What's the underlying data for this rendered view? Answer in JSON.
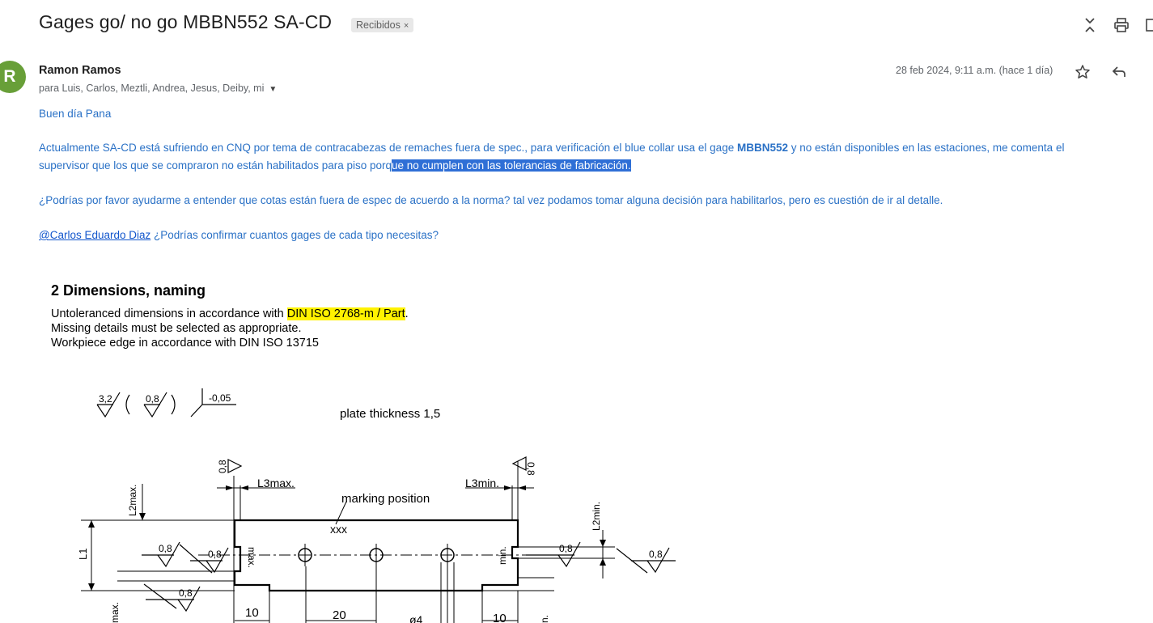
{
  "email": {
    "subject": "Gages go/ no go MBBN552 SA-CD",
    "label": "Recibidos",
    "label_close": "×",
    "avatar_letter": "R",
    "sender_name": "Ramon Ramos",
    "recipients": "para Luis, Carlos, Meztli, Andrea, Jesus, Deiby, mi",
    "date": "28 feb 2024, 9:11 a.m. (hace 1 día)",
    "greeting": "Buen día Pana",
    "para1_a": "Actualmente SA-CD está sufriendo en CNQ por tema de contracabezas de remaches fuera de spec.,  para verificación el blue collar usa el gage ",
    "para1_bold": "MBBN552",
    "para1_b": " y no están disponibles en las estaciones, me comenta el",
    "para1_c": "supervisor que los que se compraron no están habilitados para piso porq",
    "para1_selected": "ue no cumplen con las tolerancias de fabricación.",
    "para2": "¿Podrías por favor ayudarme a entender que cotas están fuera de espec de acuerdo a la norma? tal vez podamos tomar alguna decisión para habilitarlos, pero es cuestión de ir al detalle.",
    "mention": "@Carlos Eduardo Diaz",
    "para3": " ¿Podrías confirmar cuantos gages de cada tipo necesitas?"
  },
  "attachment": {
    "heading": "2  Dimensions, naming",
    "line1_a": "Untoleranced dimensions in accordance with ",
    "line1_highlight": "DIN ISO 2768-m / Part",
    "line1_b": ".",
    "line2": "Missing details must be selected as appropriate.",
    "line3": "Workpiece edge in accordance with DIN ISO 13715",
    "drawing": {
      "surface1": "3,2",
      "surface2": "0,8",
      "edge_tol": "-0,05",
      "plate_thickness": "plate thickness 1,5",
      "rough_left_top": "0,8",
      "rough_right_top": "0,8",
      "l3max": "L3max.",
      "l3min": "L3min.",
      "l2max": "L2max.",
      "l2min": "L2min.",
      "l1": "L1",
      "marking": "marking position",
      "xxx": "xxx",
      "max_label": "max.",
      "min_label": "min.",
      "r1": "0,8",
      "r2": "0,8",
      "r3": "0,8",
      "r4": "0,8",
      "r5": "0,8",
      "dim10a": "10",
      "dim20": "20",
      "dim_dia": "ø4",
      "dim10b": "10",
      "max_bottom": "max.",
      "min_bottom": "n."
    }
  },
  "icons": [
    "collapse-icon",
    "print-icon",
    "open-new-window-icon",
    "star-icon",
    "reply-icon",
    "more-icon",
    "dropdown-caret-icon"
  ]
}
